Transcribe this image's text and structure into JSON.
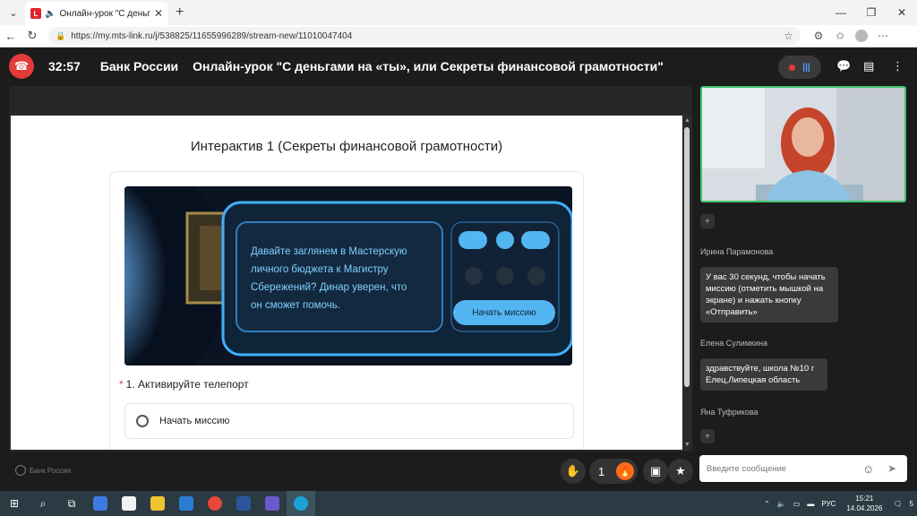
{
  "browser": {
    "tab_title": "Онлайн-урок \"С деньгами н",
    "url": "https://my.mts-link.ru/j/538825/11655996289/stream-new/11010047404"
  },
  "header": {
    "timer": "32:57",
    "organizer": "Банк России",
    "event_title": "Онлайн-урок \"С деньгами на «ты», или Секреты финансовой грамотности\""
  },
  "content": {
    "page_title": "Интерактив 1 (Секреты финансовой грамотности)",
    "banner_text": "Давайте заглянем в Мастерскую личного бюджета к Магистру Сбережений? Динар уверен, что он сможет помочь.",
    "banner_button": "Начать миссию",
    "question": "1. Активируйте телепорт",
    "required_mark": "*",
    "option_1": "Начать миссию"
  },
  "footer": {
    "watermark": "Банк России",
    "reactions_count": "1"
  },
  "chat": {
    "messages": [
      {
        "author": "Ирина Парамонова",
        "text": "У вас 30 секунд, чтобы начать миссию (отметить мышкой на экране) и нажать кнопку «Отправить»"
      },
      {
        "author": "Елена Сулимкина",
        "text": "здравствуйте, школа №10 г Елец,Липецкая область"
      },
      {
        "author": "Яна Туфрикова",
        "text": ""
      }
    ],
    "input_placeholder": "Введите сообщение"
  },
  "taskbar": {
    "lang": "РУС",
    "time": "15:21",
    "date": "14.04.2026",
    "notifications": "5"
  },
  "colors": {
    "accent_red": "#e33a3a",
    "video_border": "#41c26a",
    "fire": "#ff6a1a"
  }
}
